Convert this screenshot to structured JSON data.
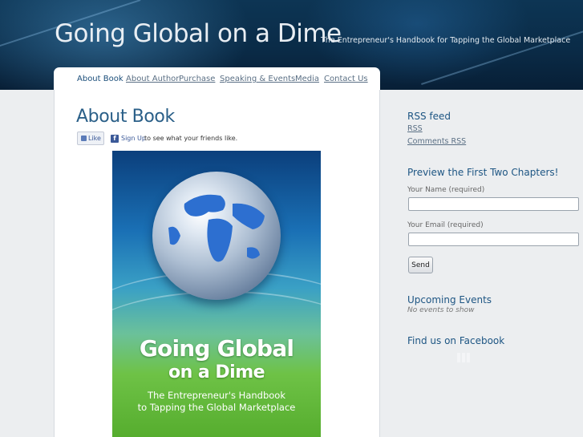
{
  "header": {
    "site_title": "Going Global on a Dime",
    "tagline": "The Entrepreneur's Handbook for Tapping the Global Marketplace"
  },
  "nav": {
    "items": [
      {
        "label": "About Book",
        "active": true
      },
      {
        "label": "About Author",
        "active": false
      },
      {
        "label": "Purchase",
        "active": false
      },
      {
        "label": "Speaking & Events",
        "active": false
      },
      {
        "label": "Media",
        "active": false
      },
      {
        "label": "Contact Us",
        "active": false
      }
    ]
  },
  "main": {
    "title": "About Book",
    "facebook": {
      "like_label": "Like",
      "signup_label": "Sign Up",
      "friends_text": "to see what your friends like."
    },
    "book_cover": {
      "title_line1": "Going Global",
      "title_line2": "on a Dime",
      "subtitle_line1": "The Entrepreneur's Handbook",
      "subtitle_line2": "to Tapping the Global Marketplace"
    }
  },
  "sidebar": {
    "rss": {
      "heading": "RSS feed",
      "links": [
        "RSS",
        "Comments RSS"
      ]
    },
    "preview": {
      "heading": "Preview the First Two Chapters!",
      "name_label": "Your Name (required)",
      "name_value": "",
      "email_label": "Your Email (required)",
      "email_value": "",
      "send_label": "Send"
    },
    "events": {
      "heading": "Upcoming Events",
      "note": "No events to show"
    },
    "facebook": {
      "heading": "Find us on Facebook"
    }
  },
  "colors": {
    "header_bg": "#0a2b47",
    "heading_blue": "#1d5583",
    "link_gray": "#5a6f84",
    "facebook_blue": "#3b5998"
  }
}
